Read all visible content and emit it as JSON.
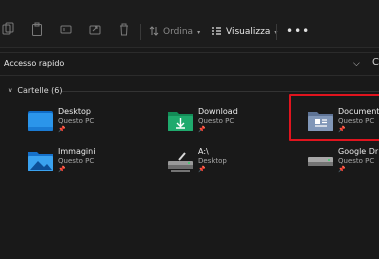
{
  "toolbar": {
    "sort_label": "Ordina",
    "view_label": "Visualizza",
    "more_label": "•••",
    "icons": [
      "copy-icon",
      "paste-icon",
      "rename-icon",
      "share-icon",
      "delete-icon",
      "sort-icon",
      "view-icon"
    ]
  },
  "address_bar": {
    "text": "Accesso rapido",
    "dropdown_glyph": "⌵",
    "refresh_glyph": "C"
  },
  "group": {
    "label": "Cartelle (6)"
  },
  "folders": [
    {
      "name": "Desktop",
      "location": "Questo PC",
      "icon": "desktop-folder-icon"
    },
    {
      "name": "Download",
      "location": "Questo PC",
      "icon": "download-folder-icon"
    },
    {
      "name": "Documenti",
      "location": "Questo PC",
      "icon": "documents-folder-icon"
    },
    {
      "name": "Immagini",
      "location": "Questo PC",
      "icon": "pictures-folder-icon"
    },
    {
      "name": "A:\\",
      "location": "Desktop",
      "icon": "network-drive-icon"
    },
    {
      "name": "Google Drive",
      "location": "Questo PC",
      "icon": "drive-icon"
    }
  ],
  "pin_glyph": "📌",
  "colors": {
    "highlight": "#e0141e",
    "desktop_icon": "#1e90e6",
    "download_icon": "#1ea36a",
    "documents_icon": "#7d93b5"
  }
}
